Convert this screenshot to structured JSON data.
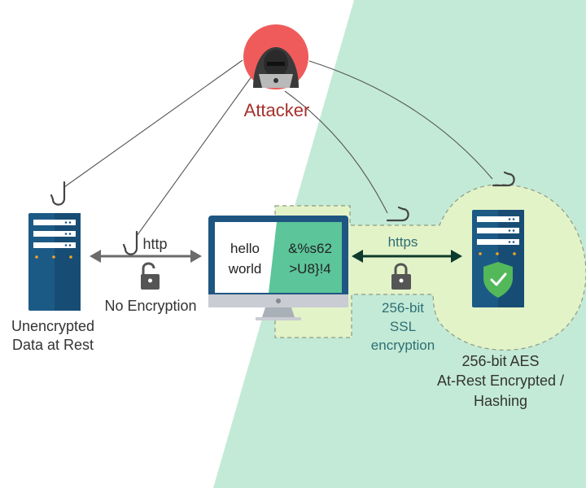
{
  "attacker": {
    "label": "Attacker"
  },
  "left_server": {
    "label_line1": "Unencrypted",
    "label_line2": "Data at Rest"
  },
  "http_link": {
    "protocol": "http",
    "caption": "No Encryption"
  },
  "monitor": {
    "plain_line1": "hello",
    "plain_line2": "world",
    "cipher_line1": "&%s62",
    "cipher_line2": ">U8}!4"
  },
  "https_link": {
    "protocol": "https",
    "caption_line1": "256-bit",
    "caption_line2": "SSL",
    "caption_line3": "encryption"
  },
  "right_server": {
    "label_line1": "256-bit AES",
    "label_line2": "At-Rest Encrypted /",
    "label_line3": "Hashing"
  },
  "colors": {
    "secure_background": "#c3ead6",
    "secure_zone": "#e3f3c8",
    "attacker_circle": "#ef5b5b",
    "attacker_text": "#a6302c",
    "server_blue": "#1c5a86",
    "shield_green": "#52b85a",
    "https_arrow": "#0e3b2d",
    "http_arrow": "#6b6b6b",
    "cipher_panel": "#5cc59a"
  },
  "icons": [
    "hacker-icon",
    "server-icon",
    "monitor-icon",
    "padlock-open-icon",
    "padlock-closed-icon",
    "fish-hook-icon",
    "shield-check-icon"
  ]
}
